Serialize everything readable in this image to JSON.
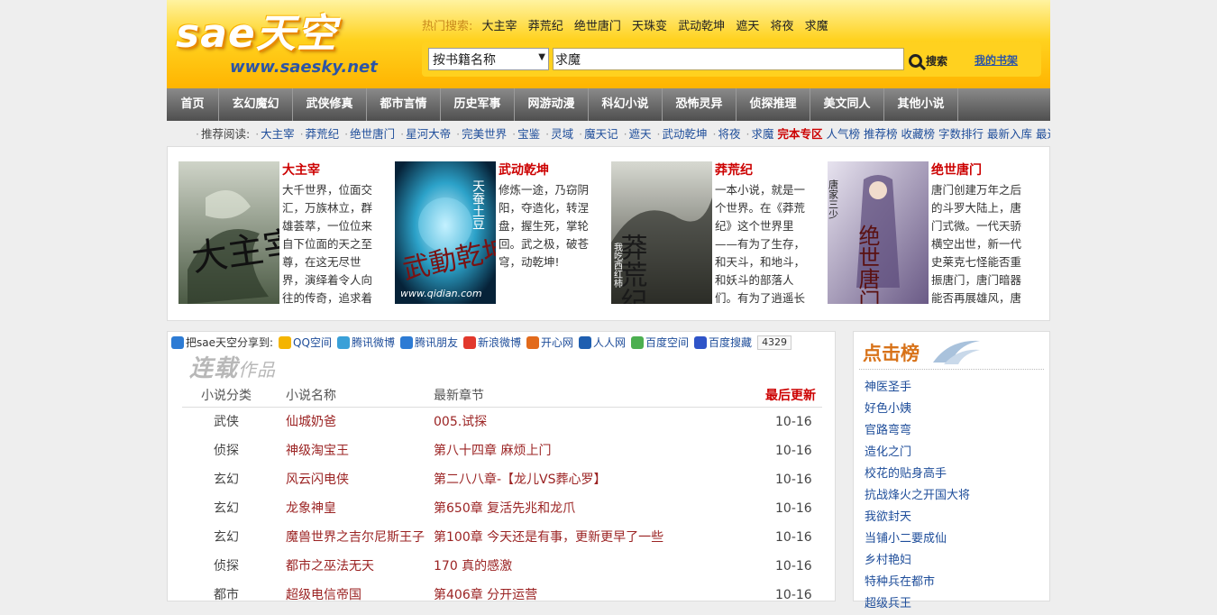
{
  "logo": {
    "main": "sae天空",
    "url": "www.saesky.net"
  },
  "hot_search": {
    "label": "热门搜索:",
    "items": [
      "大主宰",
      "莽荒纪",
      "绝世唐门",
      "天珠变",
      "武动乾坤",
      "遮天",
      "将夜",
      "求魔"
    ]
  },
  "search": {
    "select_value": "按书籍名称",
    "input_value": "求魔",
    "button_label": "搜索",
    "shelf_label": "我的书架"
  },
  "nav": [
    "首页",
    "玄幻魔幻",
    "武侠修真",
    "都市言情",
    "历史军事",
    "网游动漫",
    "科幻小说",
    "恐怖灵异",
    "侦探推理",
    "美文同人",
    "其他小说"
  ],
  "recommend": {
    "label": "推荐阅读:",
    "items": [
      "大主宰",
      "莽荒纪",
      "绝世唐门",
      "星河大帝",
      "完美世界",
      "宝鉴",
      "灵域",
      "魔天记",
      "遮天",
      "武动乾坤",
      "将夜",
      "求魔"
    ],
    "highlight": "完本专区",
    "extra": [
      "人气榜",
      "推荐榜",
      "收藏榜",
      "字数排行",
      "最新入库",
      "最近更新"
    ]
  },
  "featured": [
    {
      "title": "大主宰",
      "desc": "大千世界，位面交汇，万族林立，群雄荟萃，一位位来自下位面的天之至尊，在这无尽世界，演绎着令人向往的传奇，追求着那主宰",
      "cover_text": "大主宰"
    },
    {
      "title": "武动乾坤",
      "desc": "修炼一途，乃窃阴阳，夺造化，转涅盘，握生死，掌轮回。武之极，破苍穹，动乾坤!",
      "cover_text": "武動乾坤",
      "cover_sub": "天蚕土豆",
      "cover_url": "www.qidian.com"
    },
    {
      "title": "莽荒纪",
      "desc": "一本小说，就是一个世界。在《莽荒纪》这个世界里——有为了生存，和天斗，和地斗，和妖斗的部落人们。有为了逍遥长生，历三",
      "cover_text": "莽荒纪",
      "cover_sub": "我吃西红柿"
    },
    {
      "title": "绝世唐门",
      "desc": "唐门创建万年之后的斗罗大陆上，唐门式微。一代天骄横空出世，新一代史莱克七怪能否重振唐门，唐门暗器能否再展雄风，唐门能否重",
      "cover_text": "绝世唐门",
      "cover_sub": "唐家三少"
    }
  ],
  "share": {
    "label": "把sae天空分享到:",
    "items": [
      "QQ空间",
      "腾讯微博",
      "腾讯朋友",
      "新浪微博",
      "开心网",
      "人人网",
      "百度空间",
      "百度搜藏"
    ],
    "count": "4329"
  },
  "serial": {
    "title_main": "连载",
    "title_sub": "作品",
    "headers": {
      "category": "小说分类",
      "name": "小说名称",
      "chapter": "最新章节",
      "updated": "最后更新"
    },
    "rows": [
      {
        "category": "武侠",
        "name": "仙城奶爸",
        "chapter": "005.试探",
        "date": "10-16"
      },
      {
        "category": "侦探",
        "name": "神级淘宝王",
        "chapter": "第八十四章 麻烦上门",
        "date": "10-16"
      },
      {
        "category": "玄幻",
        "name": "风云闪电侠",
        "chapter": "第二八八章-【龙儿VS葬心罗】",
        "date": "10-16"
      },
      {
        "category": "玄幻",
        "name": "龙象神皇",
        "chapter": "第650章 复活先兆和龙爪",
        "date": "10-16"
      },
      {
        "category": "玄幻",
        "name": "魔兽世界之吉尔尼斯王子",
        "chapter": "第100章 今天还是有事，更新更早了一些",
        "date": "10-16"
      },
      {
        "category": "侦探",
        "name": "都市之巫法无天",
        "chapter": "170 真的感激",
        "date": "10-16"
      },
      {
        "category": "都市",
        "name": "超级电信帝国",
        "chapter": "第406章 分开运营",
        "date": "10-16"
      }
    ]
  },
  "ranking": {
    "title": "点击榜",
    "items": [
      "神医圣手",
      "好色小姨",
      "官路弯弯",
      "造化之门",
      "校花的贴身高手",
      "抗战烽火之开国大将",
      "我欲封天",
      "当铺小二要成仙",
      "乡村艳妇",
      "特种兵在都市",
      "超级兵王"
    ]
  }
}
